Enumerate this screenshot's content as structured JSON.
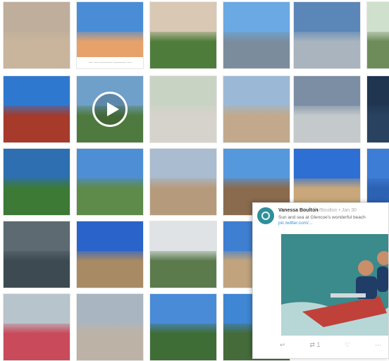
{
  "grid": {
    "rows": [
      [
        {
          "kind": "sand-toy",
          "sky": "#bfae9c",
          "ground": "#c9b59c"
        },
        {
          "kind": "sand-castle",
          "sky": "#4a8dd6",
          "ground": "#e6a26a",
          "caption": "—  — ——— ——— —"
        },
        {
          "kind": "beach-crowd",
          "sky": "#d9c8b4",
          "ground": "#4e7d3b"
        },
        {
          "kind": "person-sea",
          "sky": "#6aa9e3",
          "ground": "#7b8d9c"
        },
        {
          "kind": "sea-rocks",
          "sky": "#5b86b8",
          "ground": "#a9b4be"
        },
        {
          "kind": "greenery-edge",
          "sky": "#cfe0cc",
          "ground": "#6d8c5a"
        }
      ],
      [
        {
          "kind": "sea-plants",
          "sky": "#2f78d0",
          "ground": "#a63a2b"
        },
        {
          "kind": "video-trees",
          "sky": "#6fa0c9",
          "ground": "#4f7a3f"
        },
        {
          "kind": "path-house",
          "sky": "#c9d3c4",
          "ground": "#d6d3cc"
        },
        {
          "kind": "playground",
          "sky": "#9bb9d6",
          "ground": "#c2a98c"
        },
        {
          "kind": "boardwalk",
          "sky": "#7c8ea4",
          "ground": "#c4c9cc"
        },
        {
          "kind": "dark-edge",
          "sky": "#1f3550",
          "ground": "#294260"
        }
      ],
      [
        {
          "kind": "swimmer",
          "sky": "#2d6fb1",
          "ground": "#3c7a36"
        },
        {
          "kind": "bay-view",
          "sky": "#4d8ed4",
          "ground": "#5e8a4a"
        },
        {
          "kind": "beach-people",
          "sky": "#a9bcd0",
          "ground": "#b59b7b"
        },
        {
          "kind": "cliffs-sea",
          "sky": "#5698dc",
          "ground": "#8a6b4e"
        },
        {
          "kind": "sea-arches",
          "sky": "#2d6fd2",
          "ground": "#c9a77a"
        },
        {
          "kind": "blue-edge",
          "sky": "#3d7dd6",
          "ground": "#2c62b3"
        }
      ],
      [
        {
          "kind": "dome-structure",
          "sky": "#5d6a72",
          "ground": "#3d4a52"
        },
        {
          "kind": "beach-sand",
          "sky": "#2a63c9",
          "ground": "#a88a64"
        },
        {
          "kind": "wedding-arch",
          "sky": "#dfe3e6",
          "ground": "#5b7b4d"
        },
        {
          "kind": "umbrella-beach",
          "sky": "#3e7fd1",
          "ground": "#c1a47e"
        }
      ],
      [
        {
          "kind": "beach-toys",
          "sky": "#b8c4cc",
          "ground": "#c94a5a"
        },
        {
          "kind": "signboard",
          "sky": "#a9b6c1",
          "ground": "#bcb3a6"
        },
        {
          "kind": "sea-tree",
          "sky": "#4a8bd8",
          "ground": "#3f6d36"
        },
        {
          "kind": "sea-tree-2",
          "sky": "#3f86d4",
          "ground": "#456b3a"
        }
      ]
    ]
  },
  "tweet": {
    "author": "Vanessa Boulton",
    "handle": "@VBoulton • Jan 30",
    "text": "Sun and sea at Glencoe's wonderful beach",
    "link": "pic.twitter.com/...",
    "actions": [
      "↩",
      "⇄ 1",
      "♡",
      "⋯"
    ],
    "photo": {
      "sea": "#3b8a8c",
      "foam": "#d7eaea",
      "boat": "#c0413a",
      "shirt": "#1f3d66"
    }
  }
}
